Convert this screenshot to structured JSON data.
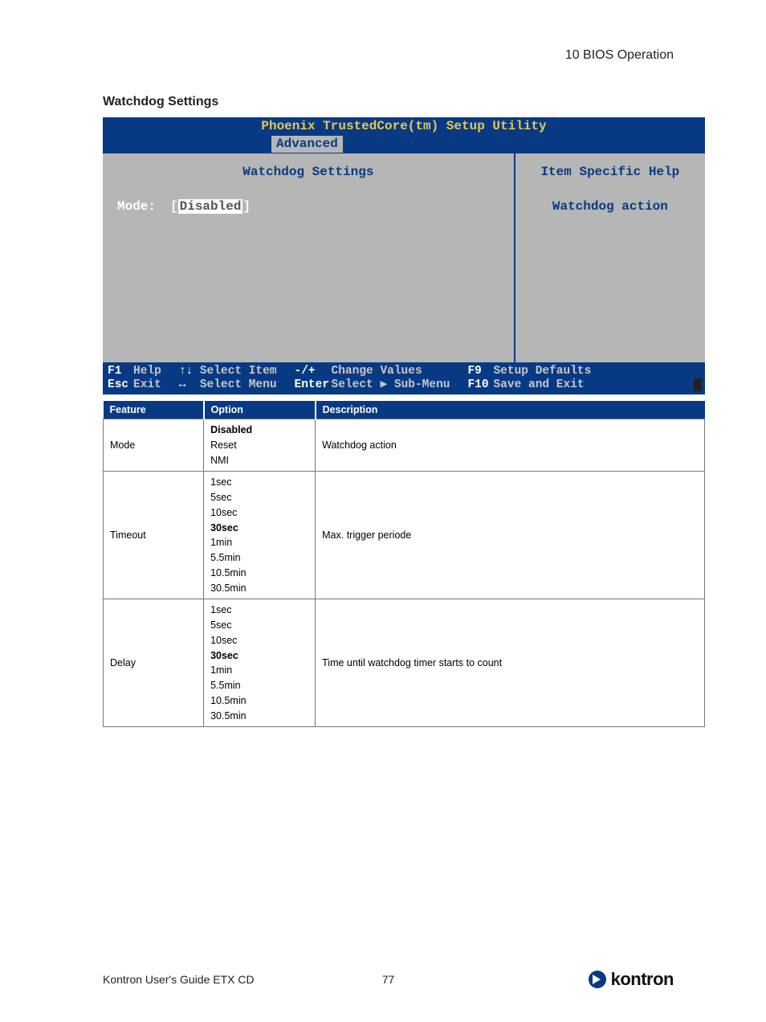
{
  "chapter": "10 BIOS Operation",
  "section_title": "Watchdog Settings",
  "bios": {
    "header": "Phoenix TrustedCore(tm) Setup Utility",
    "tab": "Advanced",
    "left_title": "Watchdog Settings",
    "right_title": "Item Specific Help",
    "mode_label": "Mode:",
    "mode_value": "Disabled",
    "help_text": "Watchdog action",
    "footer": {
      "f1": "F1",
      "help": "Help",
      "esc": "Esc",
      "exit": "Exit",
      "updown": "↑↓",
      "select_item": "Select Item",
      "leftright": "↔",
      "select_menu": "Select Menu",
      "minusplus": "-/+",
      "change_values": "Change Values",
      "enter": "Enter",
      "select_sub": "Select ▶ Sub-Menu",
      "f9": "F9",
      "setup_defaults": "Setup Defaults",
      "f10": "F10",
      "save_exit": "Save and Exit"
    }
  },
  "table": {
    "headers": {
      "feature": "Feature",
      "option": "Option",
      "description": "Description"
    },
    "rows": [
      {
        "feature": "Mode",
        "options": [
          "Disabled",
          "Reset",
          "NMI"
        ],
        "bold_idx": 0,
        "description": "Watchdog action"
      },
      {
        "feature": "Timeout",
        "options": [
          "1sec",
          "5sec",
          "10sec",
          "30sec",
          "1min",
          "5.5min",
          "10.5min",
          "30.5min"
        ],
        "bold_idx": 3,
        "description": "Max. trigger periode"
      },
      {
        "feature": "Delay",
        "options": [
          "1sec",
          "5sec",
          "10sec",
          "30sec",
          "1min",
          "5.5min",
          "10.5min",
          "30.5min"
        ],
        "bold_idx": 3,
        "description": "Time until watchdog timer starts to count"
      }
    ]
  },
  "footer": {
    "guide": "Kontron User's Guide ETX CD",
    "page": "77",
    "brand": "kontron"
  }
}
